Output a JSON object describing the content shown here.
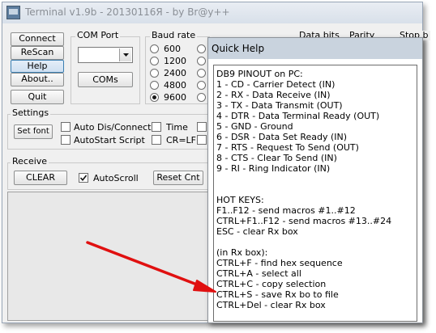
{
  "titlebar": {
    "title": "Terminal v1.9b - 20130116Я - by Br@y++"
  },
  "buttons": {
    "connect": "Connect",
    "rescan": "ReScan",
    "help": "Help",
    "about": "About..",
    "quit": "Quit"
  },
  "com_port": {
    "label": "COM Port",
    "selected": "",
    "coms_button": "COMs"
  },
  "baud_rate": {
    "label": "Baud rate",
    "options": [
      "600",
      "1200",
      "2400",
      "4800",
      "9600"
    ],
    "selected": "9600"
  },
  "partial_headers": {
    "data_bits": "Data bits",
    "parity": "Parity",
    "stop_bits": "Stop b"
  },
  "settings": {
    "label": "Settings",
    "set_font": "Set font",
    "auto_dis_connect": {
      "label": "Auto Dis/Connect",
      "checked": false
    },
    "autostart_script": {
      "label": "AutoStart Script",
      "checked": false
    },
    "time": {
      "label": "Time",
      "checked": false
    },
    "cr_lf": {
      "label": "CR=LF",
      "checked": false
    }
  },
  "receive": {
    "label": "Receive",
    "clear": "CLEAR",
    "autoscroll": {
      "label": "AutoScroll",
      "checked": true
    },
    "reset_cnt": "Reset Cnt"
  },
  "quick_help": {
    "title": "Quick Help",
    "lines": [
      "DB9 PINOUT on PC:",
      "1 - CD - Carrier Detect (IN)",
      "2 - RX - Data Receive (IN)",
      "3 - TX - Data Transmit (OUT)",
      "4 - DTR - Data Terminal Ready (OUT)",
      "5 - GND - Ground",
      "6 - DSR - Data Set Ready (IN)",
      "7 - RTS - Request To Send (OUT)",
      "8 - CTS - Clear To Send (IN)",
      "9 - RI - Ring Indicator (IN)",
      "",
      "",
      "HOT KEYS:",
      "F1..F12 - send macros #1..#12",
      "CTRL+F1..F12 - send macros #13..#24",
      "ESC - clear Rx box",
      "",
      "(in Rx box):",
      "CTRL+F - find hex sequence",
      "CTRL+A - select all",
      "CTRL+C - copy selection",
      "CTRL+S - save Rx bo to file",
      "CTRL+Del - clear Rx box"
    ]
  },
  "colors": {
    "annotation_arrow": "#e01010"
  }
}
